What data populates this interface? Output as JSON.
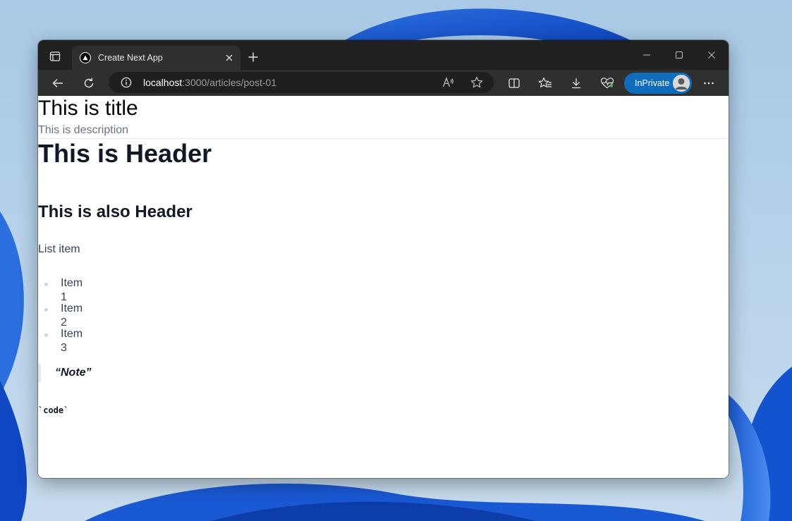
{
  "browser": {
    "tab": {
      "title": "Create Next App"
    },
    "address_bar": {
      "host": "localhost",
      "path": ":3000/articles/post-01"
    },
    "inprivate_label": "InPrivate",
    "colors": {
      "titlebar": "#202020",
      "toolbar": "#2f2f2f",
      "inprivate": "#0f6cbd"
    }
  },
  "page": {
    "title": "This is title",
    "description": "This is description",
    "header": "This is Header",
    "subheader": "This is also Header",
    "paragraph": "List item",
    "list_items": [
      "Item 1",
      "Item 2",
      "Item 3"
    ],
    "blockquote": "“Note”",
    "code": "`code`"
  },
  "icons": {
    "tab_actions": "tab-actions-icon",
    "favicon": "nextjs-triangle-icon",
    "tab_close": "close-icon",
    "new_tab": "plus-icon",
    "minimize": "minimize-icon",
    "maximize": "maximize-icon",
    "close_window": "close-icon",
    "back": "back-arrow-icon",
    "refresh": "refresh-icon",
    "site_info": "info-icon",
    "read_aloud": "read-aloud-icon",
    "favorite": "star-icon",
    "split_screen": "split-screen-icon",
    "favorites": "favorites-icon",
    "downloads": "download-icon",
    "performance": "heartbeat-icon",
    "menu": "more-icon"
  }
}
